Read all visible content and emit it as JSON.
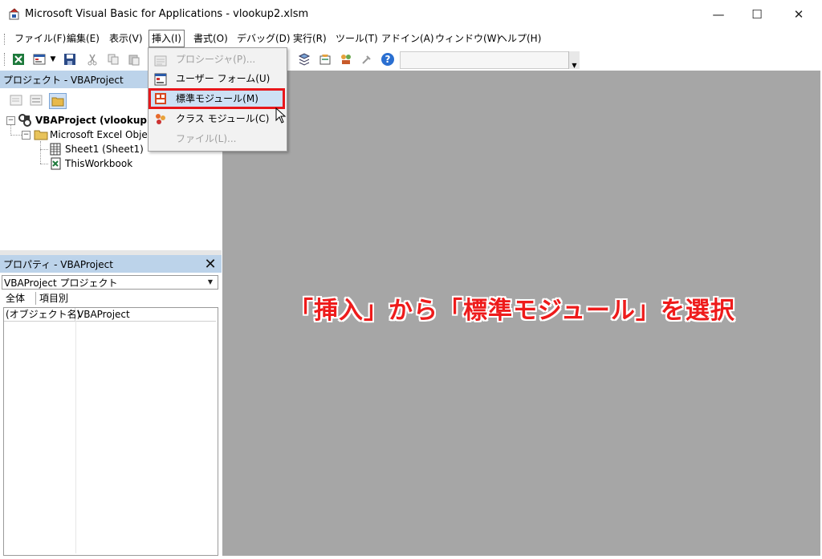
{
  "window": {
    "title": "Microsoft Visual Basic for Applications - vlookup2.xlsm",
    "minimize": "—",
    "maximize": "☐",
    "close": "✕"
  },
  "menubar": {
    "items": [
      {
        "label": "ファイル(F)"
      },
      {
        "label": "編集(E)"
      },
      {
        "label": "表示(V)"
      },
      {
        "label": "挿入(I)",
        "active": true
      },
      {
        "label": "書式(O)"
      },
      {
        "label": "デバッグ(D)"
      },
      {
        "label": "実行(R)"
      },
      {
        "label": "ツール(T)"
      },
      {
        "label": "アドイン(A)"
      },
      {
        "label": "ウィンドウ(W)"
      },
      {
        "label": "ヘルプ(H)"
      }
    ]
  },
  "insert_menu": {
    "items": [
      {
        "label": "プロシージャ(P)...",
        "enabled": false,
        "icon": "procedure-icon"
      },
      {
        "label": "ユーザー フォーム(U)",
        "enabled": true,
        "icon": "userform-icon"
      },
      {
        "label": "標準モジュール(M)",
        "enabled": true,
        "highlighted": true,
        "icon": "module-icon"
      },
      {
        "label": "クラス モジュール(C)",
        "enabled": true,
        "icon": "class-module-icon"
      },
      {
        "label": "ファイル(L)...",
        "enabled": false
      }
    ]
  },
  "project_pane": {
    "title": "プロジェクト - VBAProject",
    "tree": {
      "root": "VBAProject (vlookup2",
      "folder": "Microsoft Excel Obje",
      "items": [
        "Sheet1 (Sheet1)",
        "ThisWorkbook"
      ]
    }
  },
  "properties_pane": {
    "title": "プロパティ - VBAProject",
    "close": "✕",
    "object_select": "VBAProject プロジェクト",
    "tabs": [
      "全体",
      "項目別"
    ],
    "rows": [
      {
        "key": "(オブジェクト名)",
        "value": "VBAProject"
      }
    ]
  },
  "annotation": "「挿入」から「標準モジュール」を選択",
  "colors": {
    "pane_header": "#bcd3ea",
    "code_area": "#a6a6a6",
    "highlight_border": "#e8171b",
    "annotation_text": "#ee1b1b"
  }
}
